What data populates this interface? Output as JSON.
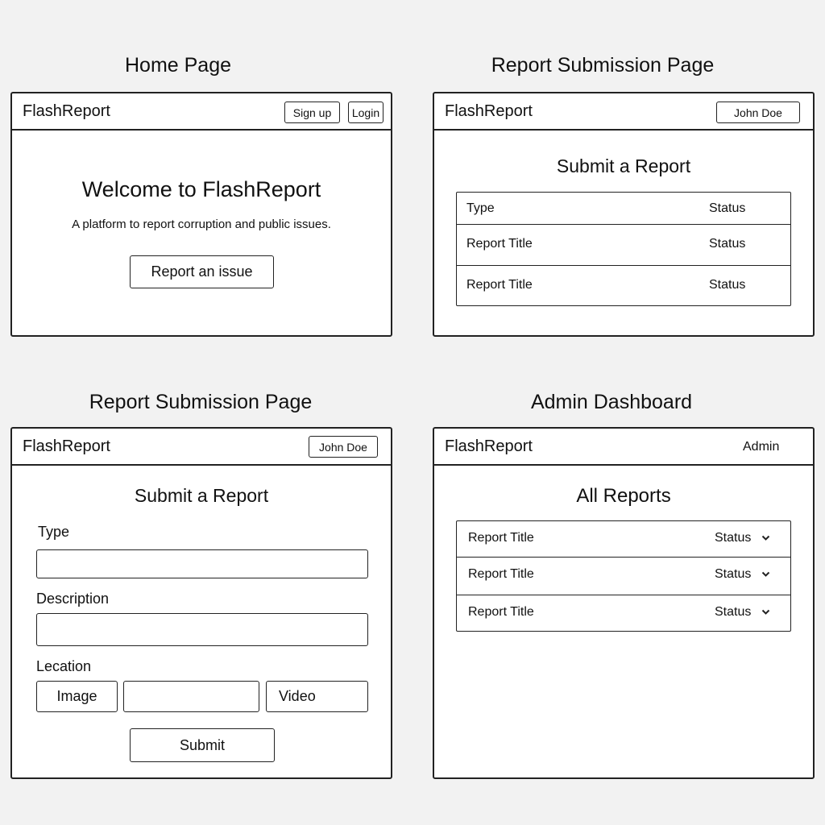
{
  "brand": "FlashReport",
  "home": {
    "page_label": "Home Page",
    "signup": "Sign up",
    "login": "Login",
    "welcome": "Welcome to FlashReport",
    "tagline": "A platform to report corruption and public issues.",
    "cta": "Report an issue"
  },
  "submission_list": {
    "page_label": "Report Submission Page",
    "user": "John Doe",
    "title": "Submit a Report",
    "header": {
      "col1": "Type",
      "col2": "Status"
    },
    "rows": [
      {
        "title": "Report Title",
        "status": "Status"
      },
      {
        "title": "Report Title",
        "status": "Status"
      }
    ]
  },
  "submission_form": {
    "page_label": "Report Submission Page",
    "user": "John Doe",
    "title": "Submit a Report",
    "type_label": "Type",
    "description_label": "Description",
    "location_label": "Lecation",
    "image_btn": "Image",
    "video_btn": "Video",
    "submit": "Submit"
  },
  "admin": {
    "page_label": "Admin Dashboard",
    "user": "Admin",
    "title": "All Reports",
    "rows": [
      {
        "title": "Report Title",
        "status": "Status"
      },
      {
        "title": "Report Title",
        "status": "Status"
      },
      {
        "title": "Report Title",
        "status": "Status"
      }
    ]
  }
}
